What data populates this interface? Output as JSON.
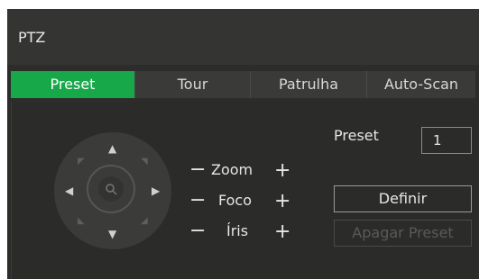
{
  "title": "PTZ",
  "tabs": [
    {
      "label": "Preset",
      "active": true
    },
    {
      "label": "Tour",
      "active": false
    },
    {
      "label": "Patrulha",
      "active": false
    },
    {
      "label": "Auto-Scan",
      "active": false
    }
  ],
  "controls": {
    "zoom": {
      "label": "Zoom",
      "minus": "−",
      "plus": "+"
    },
    "foco": {
      "label": "Foco",
      "minus": "−",
      "plus": "+"
    },
    "iris": {
      "label": "Íris",
      "minus": "−",
      "plus": "+"
    }
  },
  "preset": {
    "label": "Preset",
    "value": "1",
    "define_button": "Definir",
    "delete_button": "Apagar Preset"
  },
  "colors": {
    "accent": "#17a84a",
    "panel": "#2c2c2b"
  },
  "icons": {
    "up": "▲",
    "down": "▼",
    "left": "◀",
    "right": "▶",
    "up_left": "◤",
    "up_right": "◥",
    "down_left": "◣",
    "down_right": "◢"
  }
}
